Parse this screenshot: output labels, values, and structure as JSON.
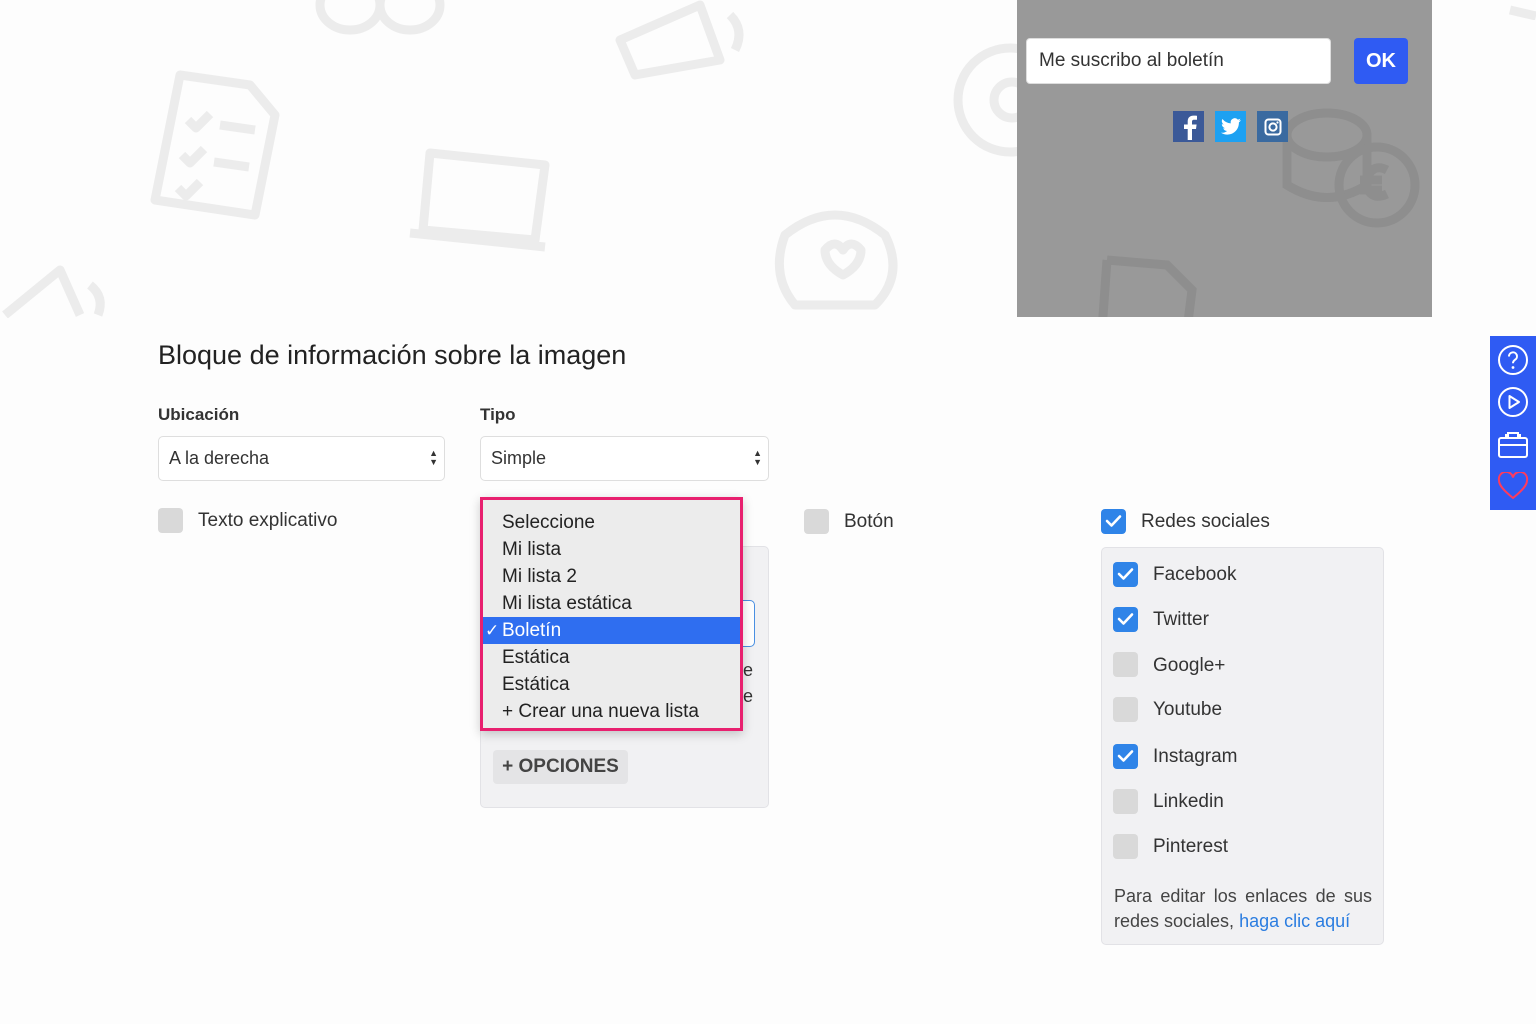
{
  "preview": {
    "subscribe_value": "Me suscribo al boletín",
    "ok_label": "OK",
    "social_icons": [
      "facebook-icon",
      "twitter-icon",
      "instagram-icon"
    ]
  },
  "colors": {
    "accent": "#2f5bf3",
    "checkbox_on": "#2f84e8",
    "dropdown_border": "#e8206f",
    "selected_item": "#2f6ef0",
    "link": "#2b7de0"
  },
  "side_tools": [
    "help-icon",
    "play-icon",
    "toolbox-icon",
    "heart-icon"
  ],
  "form": {
    "section_title": "Bloque de información sobre la imagen",
    "ubicacion": {
      "label": "Ubicación",
      "value": "A la derecha"
    },
    "tipo": {
      "label": "Tipo",
      "value": "Simple"
    },
    "texto_explicativo": {
      "label": "Texto explicativo",
      "checked": false
    },
    "boton": {
      "label": "Botón",
      "checked": false
    },
    "redes_sociales": {
      "label": "Redes sociales",
      "checked": true
    },
    "opciones_label": "+ OPCIONES",
    "peek_letters": [
      "e",
      "e"
    ]
  },
  "list_dropdown": {
    "items": [
      "Seleccione",
      "Mi lista",
      "Mi lista 2",
      "Mi lista estática",
      "Boletín",
      "Estática",
      "Estática",
      "+ Crear una nueva lista"
    ],
    "selected_index": 4,
    "check_mark": "✓"
  },
  "networks": [
    {
      "name": "Facebook",
      "checked": true
    },
    {
      "name": "Twitter",
      "checked": true
    },
    {
      "name": "Google+",
      "checked": false
    },
    {
      "name": "Youtube",
      "checked": false
    },
    {
      "name": "Instagram",
      "checked": true
    },
    {
      "name": "Linkedin",
      "checked": false
    },
    {
      "name": "Pinterest",
      "checked": false
    }
  ],
  "help": {
    "text": "Para editar los enlaces de sus redes sociales, ",
    "link": "haga clic aquí"
  }
}
